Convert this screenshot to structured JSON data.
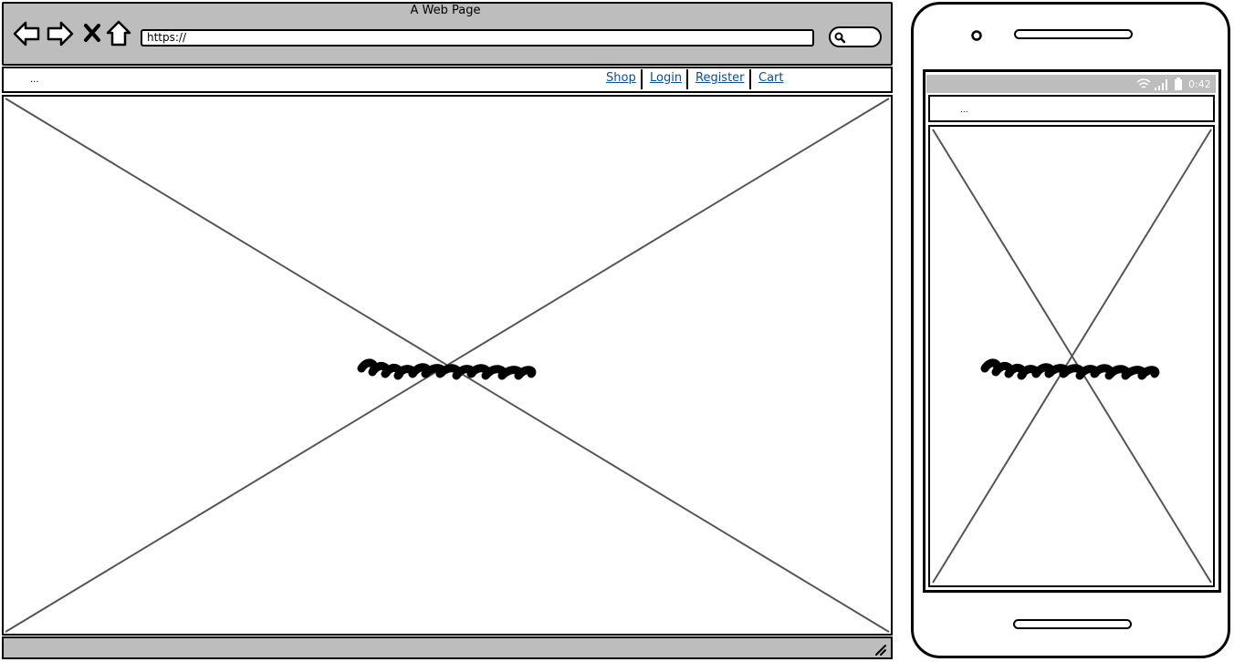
{
  "browser": {
    "title": "A Web Page",
    "url": "https://",
    "nav": {
      "menu_placeholder": "...",
      "links": [
        "Shop",
        "Login",
        "Register",
        "Cart"
      ]
    }
  },
  "phone": {
    "status_time": "0:42",
    "menu_placeholder": "..."
  },
  "colors": {
    "chrome": "#bdbdbd",
    "link": "#0b4f8c",
    "stroke": "#000000"
  },
  "icons": [
    "back-arrow-icon",
    "forward-arrow-icon",
    "close-icon",
    "home-icon",
    "search-icon",
    "resize-handle-icon",
    "camera-icon",
    "wifi-icon",
    "signal-icon",
    "battery-icon"
  ]
}
